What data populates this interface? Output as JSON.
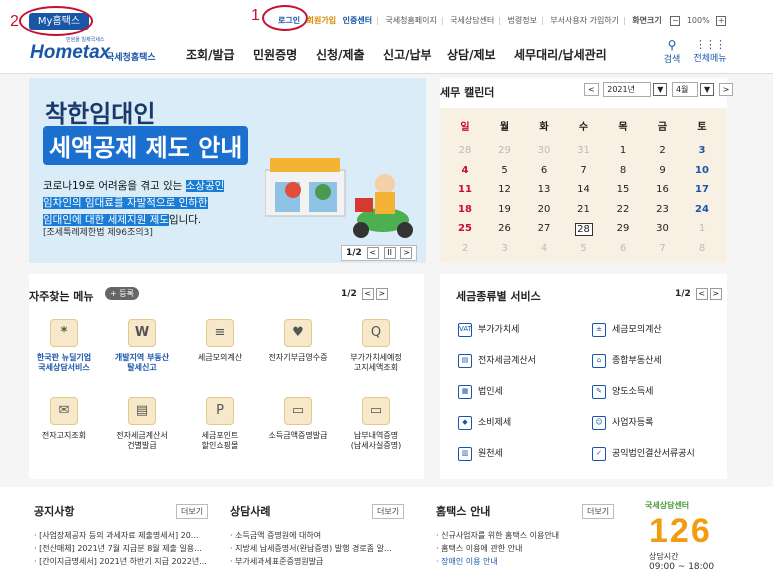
{
  "topbar": {
    "my_label": "My홈택스",
    "links": [
      "로그인",
      "회원가입",
      "인증센터",
      "국세청홈페이지",
      "국세상담센터",
      "법령정보",
      "부서사용자 가입하기",
      "화면크기"
    ],
    "zoom": "100%",
    "zoom_minus": "−",
    "zoom_plus": "+"
  },
  "annotations": {
    "one": "1",
    "two": "2"
  },
  "logo": {
    "small": "민원을 일제국세스",
    "main": "Hometax",
    "sub": "국세청홈택스"
  },
  "nav": {
    "items": [
      "조회/발급",
      "민원증명",
      "신청/제출",
      "신고/납부",
      "상담/제보",
      "세무대리/납세관리"
    ],
    "search": "검색",
    "all_menu": "전체메뉴"
  },
  "banner": {
    "title1": "착한임대인",
    "title2": "세액공제 제도 안내",
    "body_line1_plain": "코로나19로 어려움을 겪고 있는 ",
    "body_line1_hl": "소상공인",
    "body_line2_hl": "임차인의 임대료를 자발적으로 인하한",
    "body_line3_hl": "임대인에 대한 세제지원 제도",
    "body_line3_plain": "입니다.",
    "law": "[조세특례제한법 제96조의3]",
    "pager": "1/2",
    "prev": "<",
    "pause": "II",
    "next": ">"
  },
  "calendar": {
    "title": "세무 캘린더",
    "prev": "<",
    "year": "2021년",
    "month": "4월",
    "next": ">",
    "weekdays": [
      "일",
      "월",
      "화",
      "수",
      "목",
      "금",
      "토"
    ],
    "weeks": [
      [
        "28",
        "29",
        "30",
        "31",
        "1",
        "2",
        "3"
      ],
      [
        "4",
        "5",
        "6",
        "7",
        "8",
        "9",
        "10"
      ],
      [
        "11",
        "12",
        "13",
        "14",
        "15",
        "16",
        "17"
      ],
      [
        "18",
        "19",
        "20",
        "21",
        "22",
        "23",
        "24"
      ],
      [
        "25",
        "26",
        "27",
        "28",
        "29",
        "30",
        "1"
      ],
      [
        "2",
        "3",
        "4",
        "5",
        "6",
        "7",
        "8"
      ]
    ],
    "today": "28"
  },
  "favorites": {
    "title": "자주찾는 메뉴",
    "add": "+ 등록",
    "page": "1/2",
    "prev": "<",
    "next": ">",
    "items": [
      {
        "label1": "한국판 뉴딜기업",
        "label2": "국세상담서비스",
        "icon": "*"
      },
      {
        "label1": "개발지역 부동산",
        "label2": "탈세신고",
        "icon": "W"
      },
      {
        "label1": "세금모의계산",
        "label2": "",
        "icon": "≡"
      },
      {
        "label1": "전자기부금영수증",
        "label2": "",
        "icon": "♥"
      },
      {
        "label1": "부가가치세예정",
        "label2": "고지세액조회",
        "icon": "Q"
      },
      {
        "label1": "전자고지조회",
        "label2": "",
        "icon": "✉"
      },
      {
        "label1": "전자세금계산서",
        "label2": "건별발급",
        "icon": "▤"
      },
      {
        "label1": "세금포인트",
        "label2": "할인쇼핑몰",
        "icon": "P"
      },
      {
        "label1": "소득금액증명발급",
        "label2": "",
        "icon": "▭"
      },
      {
        "label1": "납부내역증명",
        "label2": "(납세사실증명)",
        "icon": "▭"
      }
    ]
  },
  "taxservices": {
    "title": "세금종류별 서비스",
    "page": "1/2",
    "prev": "<",
    "next": ">",
    "items": [
      {
        "label": "부가가치세",
        "icon": "VAT"
      },
      {
        "label": "세금모의계산",
        "icon": "±"
      },
      {
        "label": "전자세금계산서",
        "icon": "▤"
      },
      {
        "label": "종합부동산세",
        "icon": "⌂"
      },
      {
        "label": "법인세",
        "icon": "▦"
      },
      {
        "label": "양도소득세",
        "icon": "✎"
      },
      {
        "label": "소비제세",
        "icon": "◆"
      },
      {
        "label": "사업자등록",
        "icon": "☺"
      },
      {
        "label": "원천세",
        "icon": "▥"
      },
      {
        "label": "공익법인결산서류공시",
        "icon": "✓"
      }
    ]
  },
  "notices": {
    "title": "공지사항",
    "more": "더보기",
    "items": [
      "[사업장제공자 등의 과세자료 제출명세서] 20...",
      "[전산매체] 2021년 7월 지급분 8월 제출 일용...",
      "[간이지급명세서] 2021년 하반기 지급 2022년..."
    ]
  },
  "cases": {
    "title": "상담사례",
    "more": "더보기",
    "items": [
      "소득금액 증명원에 대하여",
      "지방세 납세증명서(완납증명) 발행 경로좀 알...",
      "부가세과세표준증명원발급"
    ]
  },
  "guide": {
    "title": "홈택스 안내",
    "more": "더보기",
    "items": [
      "신규사업자를 위한 홈택스 이용안내",
      "홈택스 이용에 관한 안내",
      "장애인 이용 안내"
    ]
  },
  "center126": {
    "top": "국세상담센터",
    "number": "126",
    "hours_label": "상담시간",
    "hours": "09:00 ~ 18:00"
  }
}
